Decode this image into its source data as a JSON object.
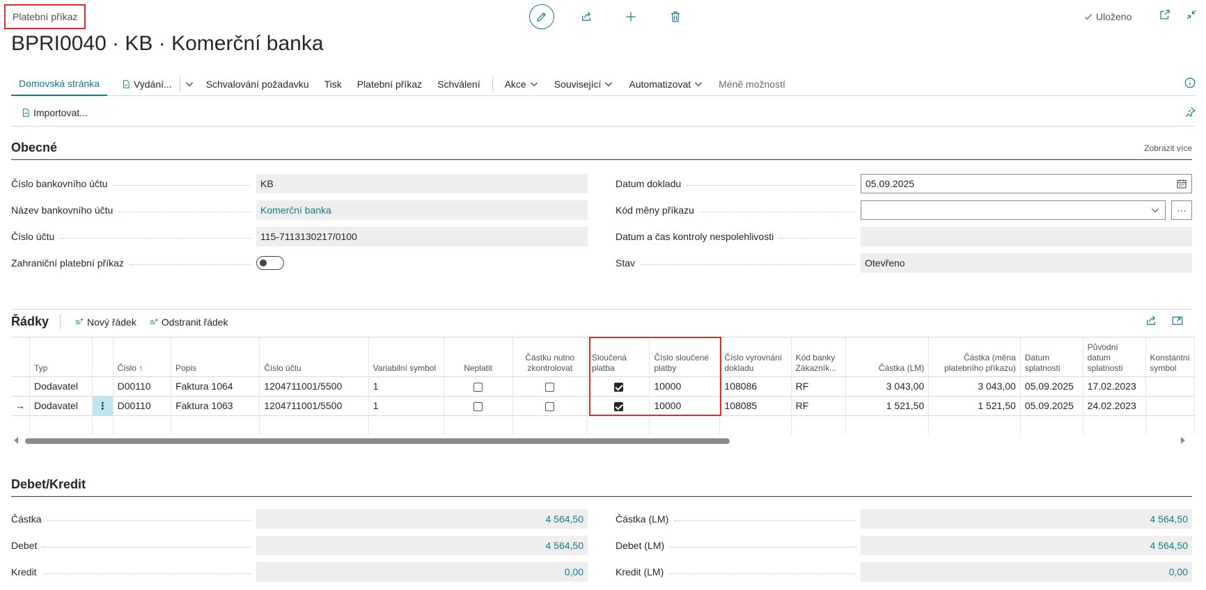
{
  "breadcrumb": "Platební příkaz",
  "title": "BPRI0040 · KB · Komerční banka",
  "toolbar": {
    "edit": "pencil-icon",
    "share": "share-icon",
    "new": "plus-icon",
    "delete": "trash-icon",
    "saved": "Uloženo"
  },
  "actions": {
    "home": "Domovská stránka",
    "issue": "Vydání...",
    "approval_request": "Schvalování požadavku",
    "print": "Tisk",
    "payment_order": "Platební příkaz",
    "approval": "Schválení",
    "actions": "Akce",
    "related": "Související",
    "automate": "Automatizovat",
    "fewer": "Méně možností",
    "import": "Importovat..."
  },
  "general": {
    "title": "Obecné",
    "show_more": "Zobrazit více",
    "bank_account_no_label": "Číslo bankovního účtu",
    "bank_account_no": "KB",
    "bank_account_name_label": "Název bankovního účtu",
    "bank_account_name": "Komerční banka",
    "account_no_label": "Číslo účtu",
    "account_no": "115-7113130217/0100",
    "foreign_label": "Zahraniční platební příkaz",
    "foreign": false,
    "doc_date_label": "Datum dokladu",
    "doc_date": "05.09.2025",
    "currency_label": "Kód měny příkazu",
    "currency": "",
    "unreliability_label": "Datum a čas kontroly nespolehlivosti",
    "unreliability": "",
    "status_label": "Stav",
    "status": "Otevřeno"
  },
  "lines": {
    "title": "Řádky",
    "new_line": "Nový řádek",
    "delete_line": "Odstranit řádek",
    "columns": {
      "type": "Typ",
      "no": "Číslo ↑",
      "description": "Popis",
      "account_no": "Číslo účtu",
      "var_symbol": "Variabilní symbol",
      "skip": "Neplatit",
      "amount_check": "Částku nutno zkontrolovat",
      "merged": "Sloučená platba",
      "merged_no": "Číslo sloučené platby",
      "applies_to": "Číslo vyrovnání dokladu",
      "bank_code": "Kód banky Zákazník...",
      "amount_lcy": "Částka (LM)",
      "amount_order": "Částka (měna platebního příkazu)",
      "due_date": "Datum splatnosti",
      "orig_due_date": "Původní datum splatnosti",
      "const_symbol": "Konstantní symbol"
    },
    "rows": [
      {
        "type": "Dodavatel",
        "no": "D00110",
        "description": "Faktura 1064",
        "account_no": "1204711001/5500",
        "var_symbol": "1",
        "skip": false,
        "amount_check": false,
        "merged": true,
        "merged_no": "10000",
        "applies_to": "108086",
        "bank_code": "RF",
        "amount_lcy": "3 043,00",
        "amount_order": "3 043,00",
        "due_date": "05.09.2025",
        "orig_due_date": "17.02.2023",
        "const_symbol": ""
      },
      {
        "type": "Dodavatel",
        "no": "D00110",
        "description": "Faktura 1063",
        "account_no": "1204711001/5500",
        "var_symbol": "1",
        "skip": false,
        "amount_check": false,
        "merged": true,
        "merged_no": "10000",
        "applies_to": "108085",
        "bank_code": "RF",
        "amount_lcy": "1 521,50",
        "amount_order": "1 521,50",
        "due_date": "05.09.2025",
        "orig_due_date": "24.02.2023",
        "const_symbol": ""
      }
    ],
    "current_row_marker": "→",
    "row_menu": "⋮"
  },
  "debit_credit": {
    "title": "Debet/Kredit",
    "amount_label": "Částka",
    "amount": "4 564,50",
    "debit_label": "Debet",
    "debit": "4 564,50",
    "credit_label": "Kredit",
    "credit": "0,00",
    "amount_lcy_label": "Částka (LM)",
    "amount_lcy": "4 564,50",
    "debit_lcy_label": "Debet (LM)",
    "debit_lcy": "4 564,50",
    "credit_lcy_label": "Kredit (LM)",
    "credit_lcy": "0,00"
  },
  "colors": {
    "accent": "#0f7c8c",
    "highlight": "#e02b2b"
  }
}
